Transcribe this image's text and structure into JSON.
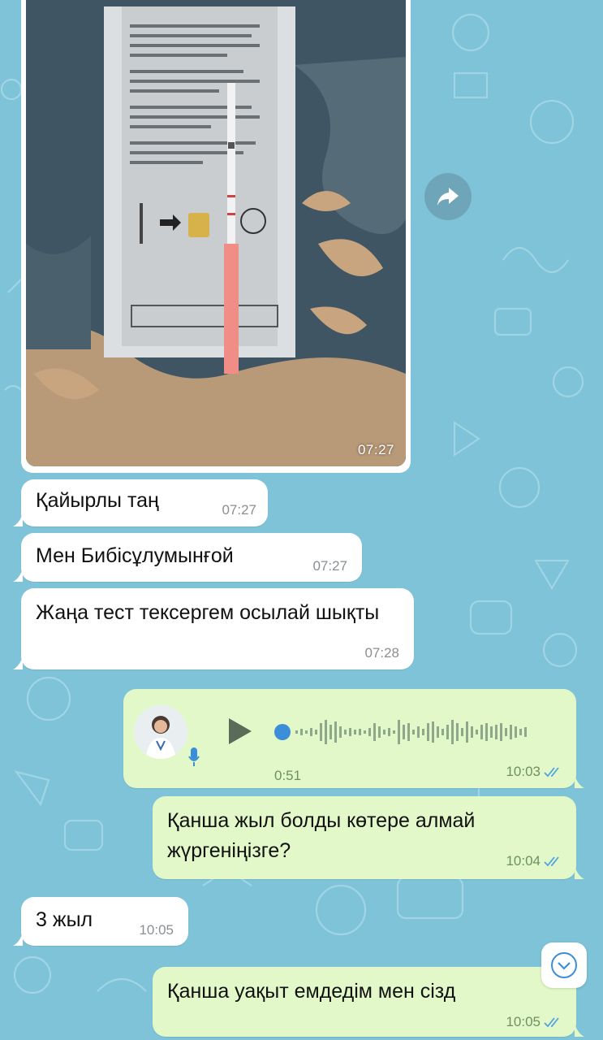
{
  "colors": {
    "wallpaper": "#7ec3d8",
    "incoming_bubble": "#ffffff",
    "outgoing_bubble": "#e3f8c9",
    "read_ticks": "#4fa3e0",
    "voice_accent": "#3a8fd8"
  },
  "photo_message": {
    "time": "07:27"
  },
  "messages": [
    {
      "direction": "in",
      "text": "Қайырлы таң",
      "time": "07:27"
    },
    {
      "direction": "in",
      "text": "Мен Бибісұлумынғой",
      "time": "07:27"
    },
    {
      "direction": "in",
      "text": "Жаңа тест тексергем осылай шықты",
      "time": "07:28"
    },
    {
      "direction": "out",
      "type": "voice",
      "duration": "0:51",
      "time": "10:03",
      "status": "read"
    },
    {
      "direction": "out",
      "text": "Қанша жыл болды көтере алмай жүргеніңізге?",
      "time": "10:04",
      "status": "read"
    },
    {
      "direction": "in",
      "text": "3 жыл",
      "time": "10:05"
    },
    {
      "direction": "out",
      "text": "Қанша уақыт емдедім мен сізд",
      "time": "10:05",
      "status": "read"
    }
  ],
  "icons": {
    "forward": "forward-icon",
    "play": "play-icon",
    "mic": "microphone-icon",
    "scroll_down": "chevron-down-icon",
    "read": "double-check-icon"
  }
}
